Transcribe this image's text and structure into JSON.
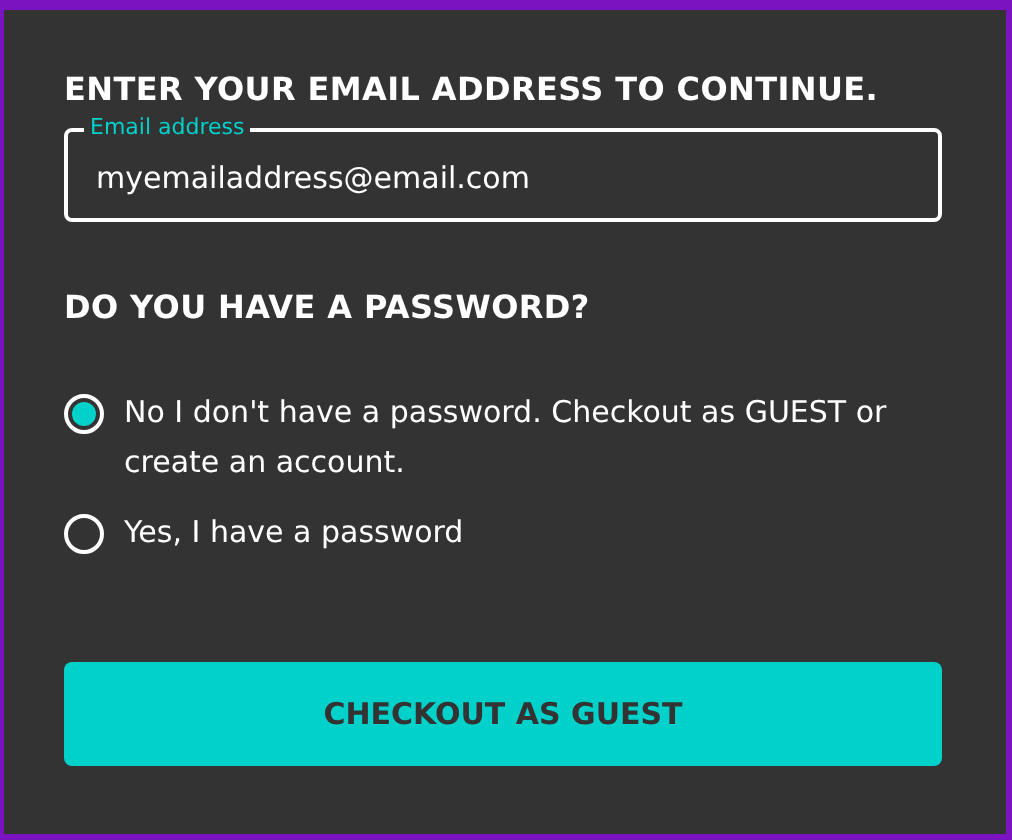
{
  "email_section": {
    "heading": "ENTER YOUR EMAIL ADDRESS TO CONTINUE.",
    "field": {
      "label": "Email address",
      "value": "myemailaddress@email.com"
    }
  },
  "password_section": {
    "heading": "DO YOU HAVE A PASSWORD?",
    "options": [
      {
        "label": "No I don't have a password. Checkout as GUEST or create an account.",
        "selected": true
      },
      {
        "label": "Yes, I have a password",
        "selected": false
      }
    ]
  },
  "button": {
    "label": "CHECKOUT AS GUEST"
  }
}
